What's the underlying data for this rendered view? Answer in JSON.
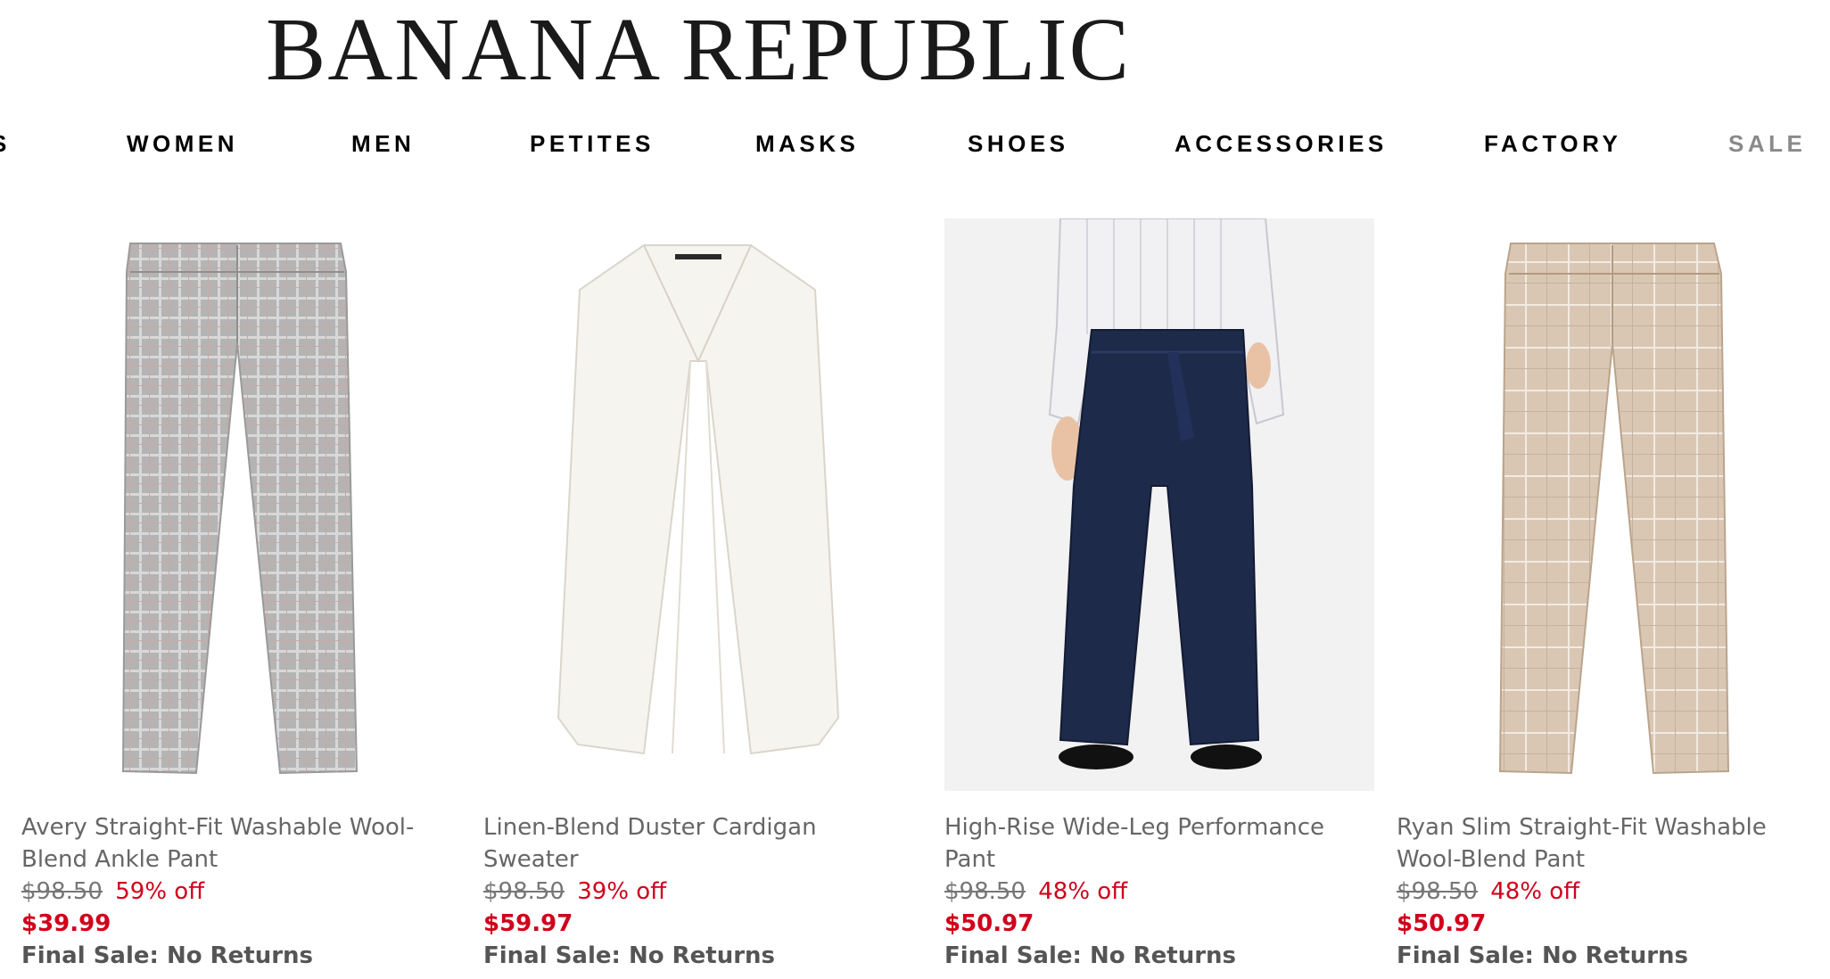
{
  "brand": "BANANA REPUBLIC",
  "nav": [
    "WOMEN",
    "MEN",
    "PETITES",
    "MASKS",
    "SHOES",
    "ACCESSORIES",
    "FACTORY",
    "SALE"
  ],
  "nav_partial": "S",
  "products": [
    {
      "name": "Avery Straight-Fit Washable Wool-Blend Ankle Pant",
      "original_price": "$98.50",
      "discount": "59% off",
      "sale_price": "$39.99",
      "note": "Final Sale: No Returns",
      "image": "grey-plaid-pant-image"
    },
    {
      "name": "Linen-Blend Duster Cardigan Sweater",
      "original_price": "$98.50",
      "discount": "39% off",
      "sale_price": "$59.97",
      "note": "Final Sale: No Returns",
      "image": "white-cardigan-image"
    },
    {
      "name": "High-Rise Wide-Leg Performance Pant",
      "original_price": "$98.50",
      "discount": "48% off",
      "sale_price": "$50.97",
      "note": "Final Sale: No Returns",
      "image": "navy-wide-leg-pant-model-image"
    },
    {
      "name": "Ryan Slim Straight-Fit Washable Wool-Blend Pant",
      "original_price": "$98.50",
      "discount": "48% off",
      "sale_price": "$50.97",
      "note": "Final Sale: No Returns",
      "image": "beige-plaid-pant-image"
    }
  ],
  "colors": {
    "sale_red": "#d0021b",
    "nav_sale_grey": "#8a8a8a",
    "text_grey": "#666666"
  }
}
